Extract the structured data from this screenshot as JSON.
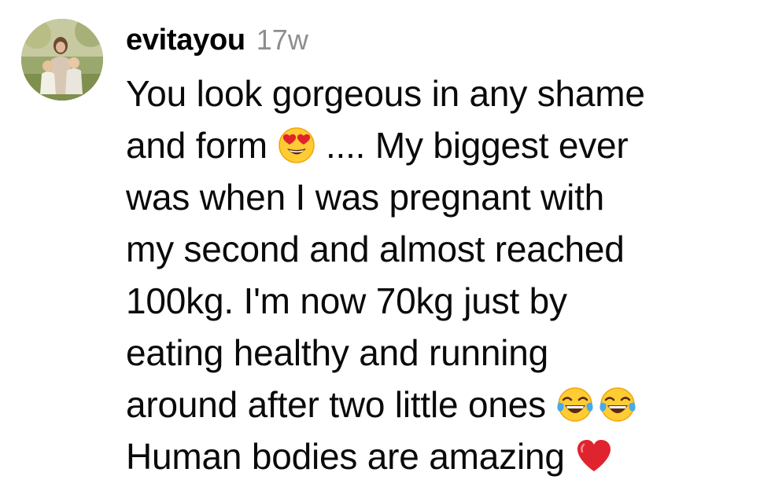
{
  "comment": {
    "username": "evitayou",
    "timestamp": "17w",
    "avatar_icon": "profile-photo",
    "lines": [
      [
        "You look gorgeous in any shame"
      ],
      [
        "and form",
        "heart-eyes-emoji",
        ".... My biggest ever"
      ],
      [
        "was when I was pregnant with"
      ],
      [
        "my second and almost reached"
      ],
      [
        "100kg. I'm now 70kg just by"
      ],
      [
        "eating healthy and running"
      ],
      [
        "around after two little ones",
        "tears-of-joy-emoji",
        "tears-of-joy-emoji"
      ],
      [
        "Human bodies are amazing",
        "red-heart-emoji"
      ]
    ],
    "line_text": {
      "l1": "You look gorgeous in any shame",
      "l2a": "and form",
      "l2b": ".... My biggest ever",
      "l3": "was when I was pregnant with",
      "l4": "my second and almost reached",
      "l5": "100kg. I'm now 70kg just by",
      "l6": "eating healthy and running",
      "l7": "around after two little ones",
      "l8": "Human bodies are amazing"
    }
  },
  "colors": {
    "text": "#0a0a0a",
    "username": "#000000",
    "timestamp": "#8e8e8e",
    "emoji_face": "#ffcc33",
    "heart": "#e0242f"
  }
}
